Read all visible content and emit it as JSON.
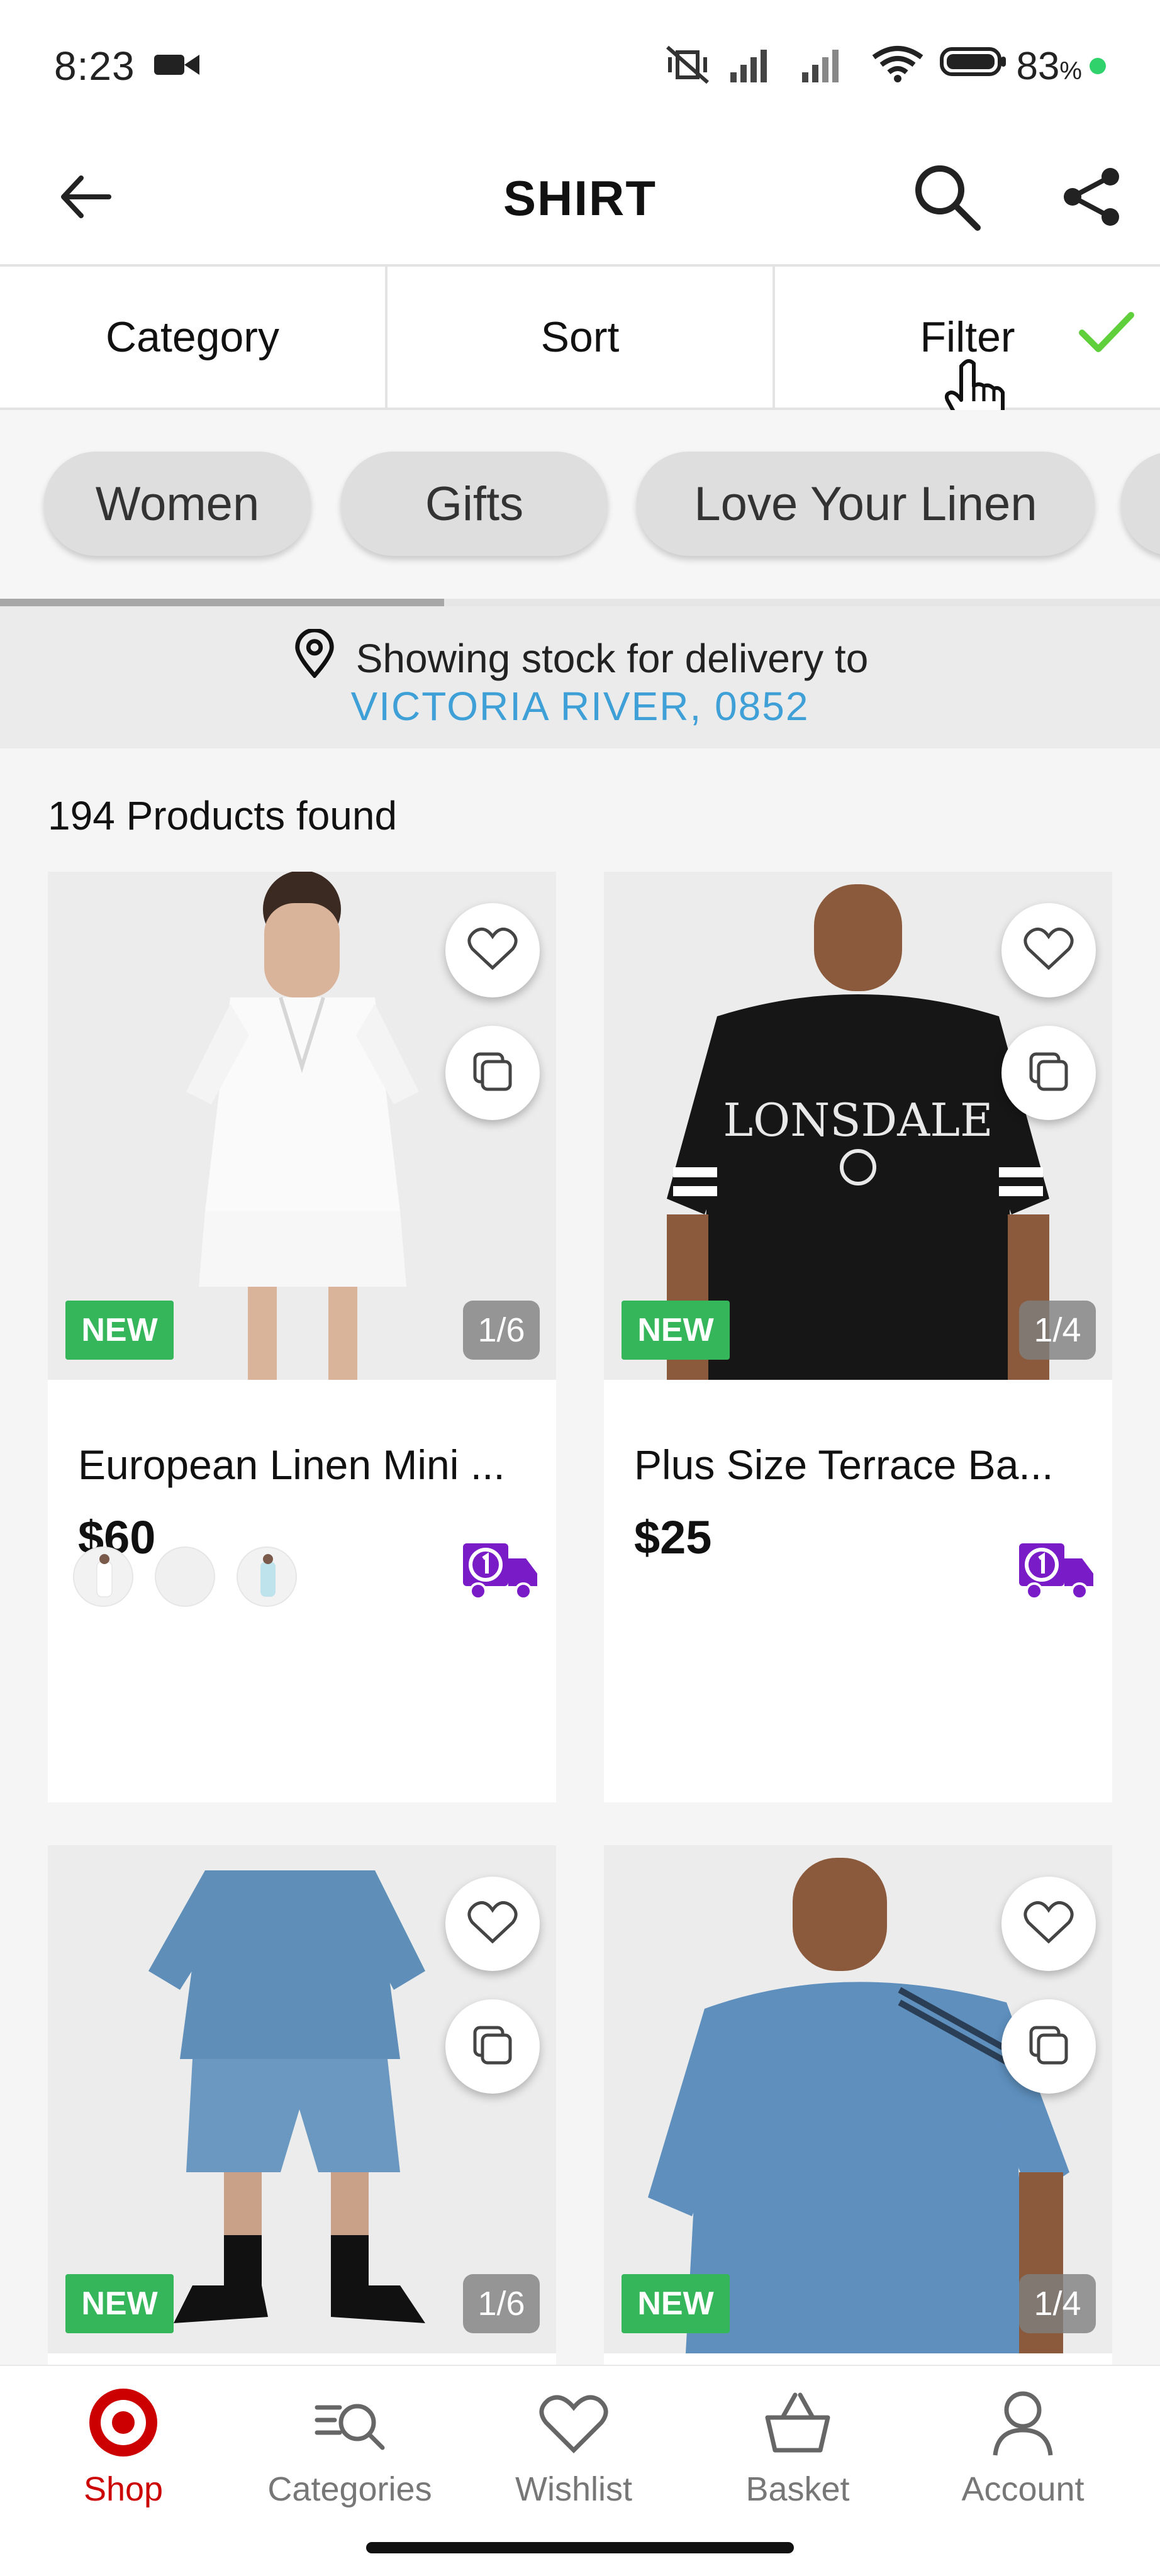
{
  "status_bar": {
    "time": "8:23",
    "battery_percent": "83",
    "battery_suffix": "%"
  },
  "header": {
    "title": "SHIRT"
  },
  "controls": {
    "category": "Category",
    "sort": "Sort",
    "filter": "Filter"
  },
  "chips": [
    "Women",
    "Gifts",
    "Love Your Linen"
  ],
  "delivery": {
    "line1": "Showing stock for delivery to",
    "location": "VICTORIA RIVER, 0852"
  },
  "results": {
    "count_text": "194 Products found"
  },
  "products": [
    {
      "name": "European Linen Mini ...",
      "price": "$60",
      "badge": "NEW",
      "counter": "1/6"
    },
    {
      "name": "Plus Size Terrace Ba...",
      "price": "$25",
      "badge": "NEW",
      "counter": "1/4"
    },
    {
      "badge": "NEW",
      "counter": "1/6"
    },
    {
      "badge": "NEW",
      "counter": "1/4"
    }
  ],
  "bottom_nav": {
    "items": [
      {
        "label": "Shop"
      },
      {
        "label": "Categories"
      },
      {
        "label": "Wishlist"
      },
      {
        "label": "Basket"
      },
      {
        "label": "Account"
      }
    ]
  },
  "colors": {
    "brand_red": "#cc0000",
    "new_badge_green": "#36b65a",
    "location_blue": "#3ea0d6",
    "delivery_purple": "#7a1bc8",
    "check_green": "#5fcf3c"
  }
}
